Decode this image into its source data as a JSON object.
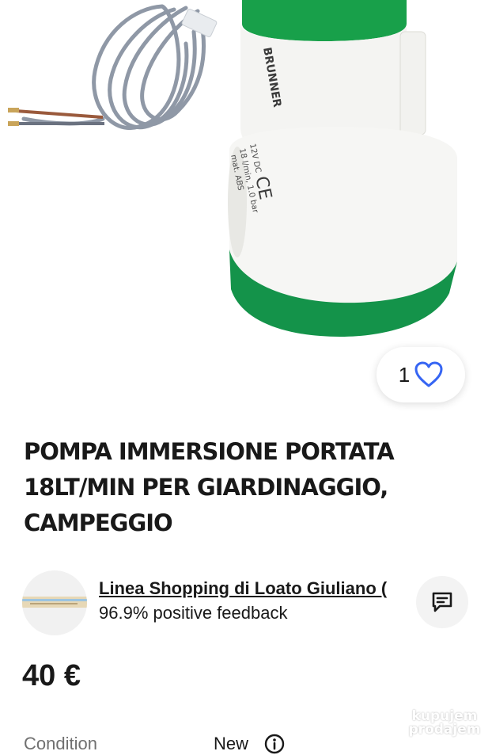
{
  "listing": {
    "like_count": "1",
    "title": "POMPA IMMERSIONE PORTATA 18LT/MIN PER GIARDINAGGIO, CAMPEGGIO",
    "price": "40 €"
  },
  "product_label": {
    "brand": "BRUNNER",
    "spec_line_1": "12V DC",
    "spec_line_2": "18 l/min, 1.0 bar",
    "spec_line_3": "mat. ABS",
    "ce_mark": "CE"
  },
  "seller": {
    "name": "Linea Shopping di Loato Giuliano (",
    "feedback": "96.9% positive feedback"
  },
  "details": {
    "condition_label": "Condition",
    "condition_value": "New"
  },
  "watermark": {
    "line1": "kupujem",
    "line2": "prodajem"
  },
  "colors": {
    "pump_green": "#18a04a",
    "pump_white": "#f4f4f2",
    "heart_blue": "#3665f3",
    "text": "#191919"
  },
  "icons": {
    "like": "heart-icon",
    "message": "chat-bubble-icon",
    "info": "info-icon"
  }
}
